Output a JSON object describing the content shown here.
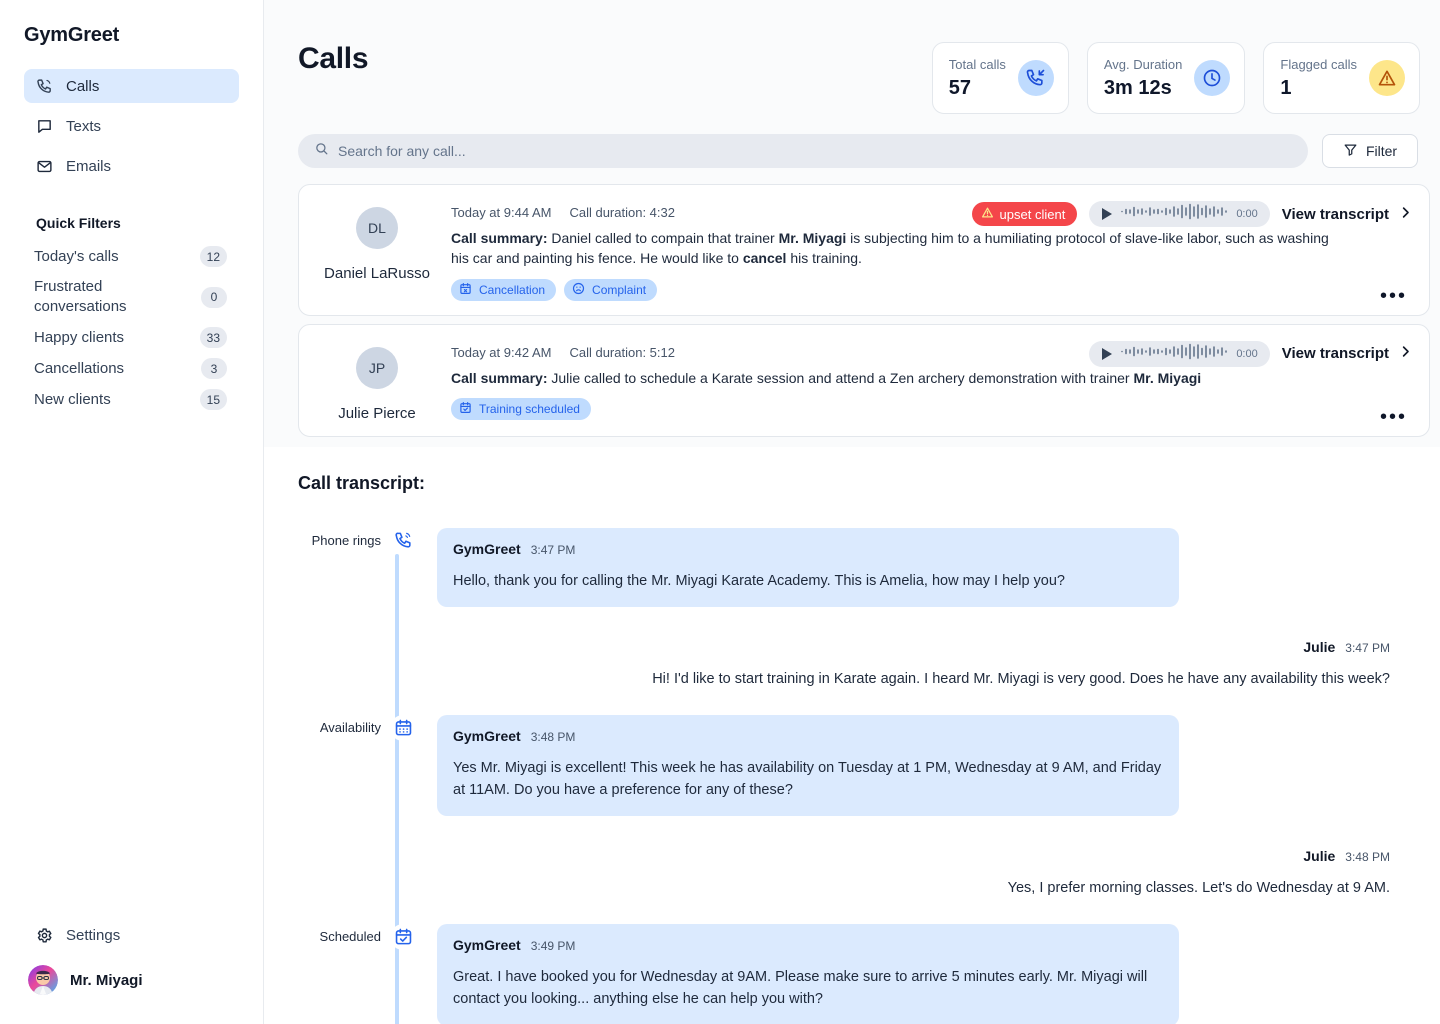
{
  "sidebar": {
    "brand": "GymGreet",
    "nav": [
      {
        "label": "Calls",
        "icon": "phone-call-icon",
        "active": true
      },
      {
        "label": "Texts",
        "icon": "message-icon",
        "active": false
      },
      {
        "label": "Emails",
        "icon": "envelope-icon",
        "active": false
      }
    ],
    "quick_filters_title": "Quick Filters",
    "quick_filters": [
      {
        "label": "Today's calls",
        "count": "12"
      },
      {
        "label": "Frustrated conversations",
        "count": "0"
      },
      {
        "label": "Happy clients",
        "count": "33"
      },
      {
        "label": "Cancellations",
        "count": "3"
      },
      {
        "label": "New clients",
        "count": "15"
      }
    ],
    "settings_label": "Settings",
    "settings_icon": "gear-icon",
    "user_name": "Mr. Miyagi"
  },
  "header": {
    "title": "Calls",
    "stats": [
      {
        "label": "Total calls",
        "value": "57",
        "icon": "incoming-call-icon",
        "badge_color": "#bfdbfe"
      },
      {
        "label": "Avg. Duration",
        "value": "3m 12s",
        "icon": "clock-icon",
        "badge_color": "#bfdbfe"
      },
      {
        "label": "Flagged calls",
        "value": "1",
        "icon": "warning-triangle-icon",
        "badge_color": "#fde68a"
      }
    ]
  },
  "search": {
    "placeholder": "Search for any call...",
    "icon": "search-icon",
    "filter_label": "Filter",
    "filter_icon": "funnel-icon"
  },
  "calls": [
    {
      "initials": "DL",
      "name": "Daniel LaRusso",
      "time": "Today at 9:44 AM",
      "duration": "Call duration: 4:32",
      "summary_label": "Call summary:",
      "summary_part1": " Daniel called to compain that trainer ",
      "summary_bold1": "Mr. Miyagi",
      "summary_part2": " is subjecting him to a humiliating protocol of slave-like labor, such as washing his car and painting his fence. He would like to ",
      "summary_bold2": "cancel",
      "summary_part3": " his training.",
      "tags": [
        {
          "label": "Cancellation",
          "icon": "calendar-x-icon"
        },
        {
          "label": "Complaint",
          "icon": "frown-face-icon"
        }
      ],
      "flag": {
        "label": "upset client",
        "icon": "warning-triangle-icon",
        "color": "#f4464a"
      },
      "player_time": "0:00",
      "view_transcript": "View transcript",
      "menu_icon": "more-options-icon"
    },
    {
      "initials": "JP",
      "name": "Julie Pierce",
      "time": "Today at 9:42 AM",
      "duration": "Call duration: 5:12",
      "summary_label": "Call summary:",
      "summary_part1": " Julie called to schedule a Karate session and attend a Zen archery demonstration with trainer ",
      "summary_bold1": "Mr. Miyagi",
      "summary_part2": "",
      "summary_bold2": "",
      "summary_part3": "",
      "tags": [
        {
          "label": "Training scheduled",
          "icon": "calendar-check-icon"
        }
      ],
      "flag": null,
      "player_time": "0:00",
      "view_transcript": "View transcript",
      "menu_icon": "more-options-icon"
    }
  ],
  "transcript": {
    "title": "Call transcript:",
    "markers": {
      "phone_rings": "Phone rings",
      "availability": "Availability",
      "scheduled": "Scheduled"
    },
    "messages": [
      {
        "side": "left",
        "who": "GymGreet",
        "time": "3:47 PM",
        "text": "Hello, thank you for calling the Mr. Miyagi Karate Academy. This is Amelia, how may I help you?"
      },
      {
        "side": "right",
        "who": "Julie",
        "time": "3:47 PM",
        "text": "Hi! I'd like to start training in Karate again. I heard Mr. Miyagi is very good. Does he have any availability this week?"
      },
      {
        "side": "left",
        "who": "GymGreet",
        "time": "3:48 PM",
        "text": "Yes Mr. Miyagi is excellent! This week he has availability on Tuesday at 1 PM, Wednesday at 9 AM, and Friday at 11AM. Do you have a preference for any of these?"
      },
      {
        "side": "right",
        "who": "Julie",
        "time": "3:48 PM",
        "text": "Yes, I prefer morning classes. Let's do Wednesday at 9 AM."
      },
      {
        "side": "left",
        "who": "GymGreet",
        "time": "3:49 PM",
        "text": "Great. I have booked you for Wednesday at 9AM. Please make sure to arrive 5 minutes early. Mr. Miyagi will contact you looking... anything else he can help you with?"
      }
    ]
  }
}
